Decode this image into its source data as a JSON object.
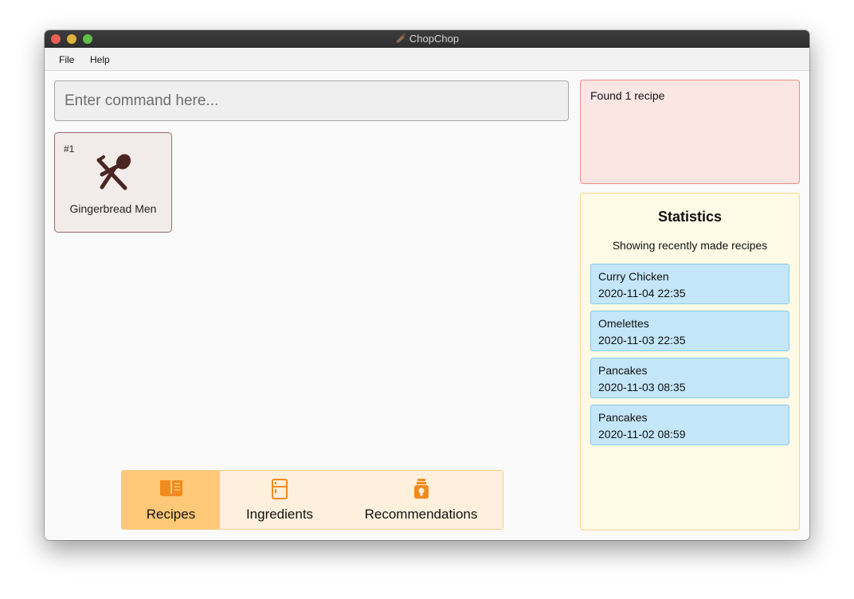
{
  "window": {
    "title": "ChopChop"
  },
  "menu": {
    "items": [
      "File",
      "Help"
    ]
  },
  "command": {
    "placeholder": "Enter command here...",
    "value": ""
  },
  "recipes": [
    {
      "index": "#1",
      "name": "Gingerbread Men",
      "icon": "cutlery-icon"
    }
  ],
  "tabs": [
    {
      "label": "Recipes",
      "icon": "book-icon",
      "active": true
    },
    {
      "label": "Ingredients",
      "icon": "fridge-icon",
      "active": false
    },
    {
      "label": "Recommendations",
      "icon": "bulb-jar-icon",
      "active": false
    }
  ],
  "result": {
    "text": "Found 1 recipe"
  },
  "statistics": {
    "title": "Statistics",
    "subtitle": "Showing recently made recipes",
    "items": [
      {
        "name": "Curry Chicken",
        "date": "2020-11-04 22:35"
      },
      {
        "name": "Omelettes",
        "date": "2020-11-03 22:35"
      },
      {
        "name": "Pancakes",
        "date": "2020-11-03 08:35"
      },
      {
        "name": "Pancakes",
        "date": "2020-11-02 08:59"
      }
    ]
  },
  "colors": {
    "accent": "#f28a1e",
    "active_tab": "#ffc879",
    "tab_bar": "#fff0dd",
    "result_bg": "#fbe6e4",
    "stats_bg": "#fefae6",
    "stat_card": "#c3e6f9",
    "recipe_icon": "#4a2622"
  }
}
